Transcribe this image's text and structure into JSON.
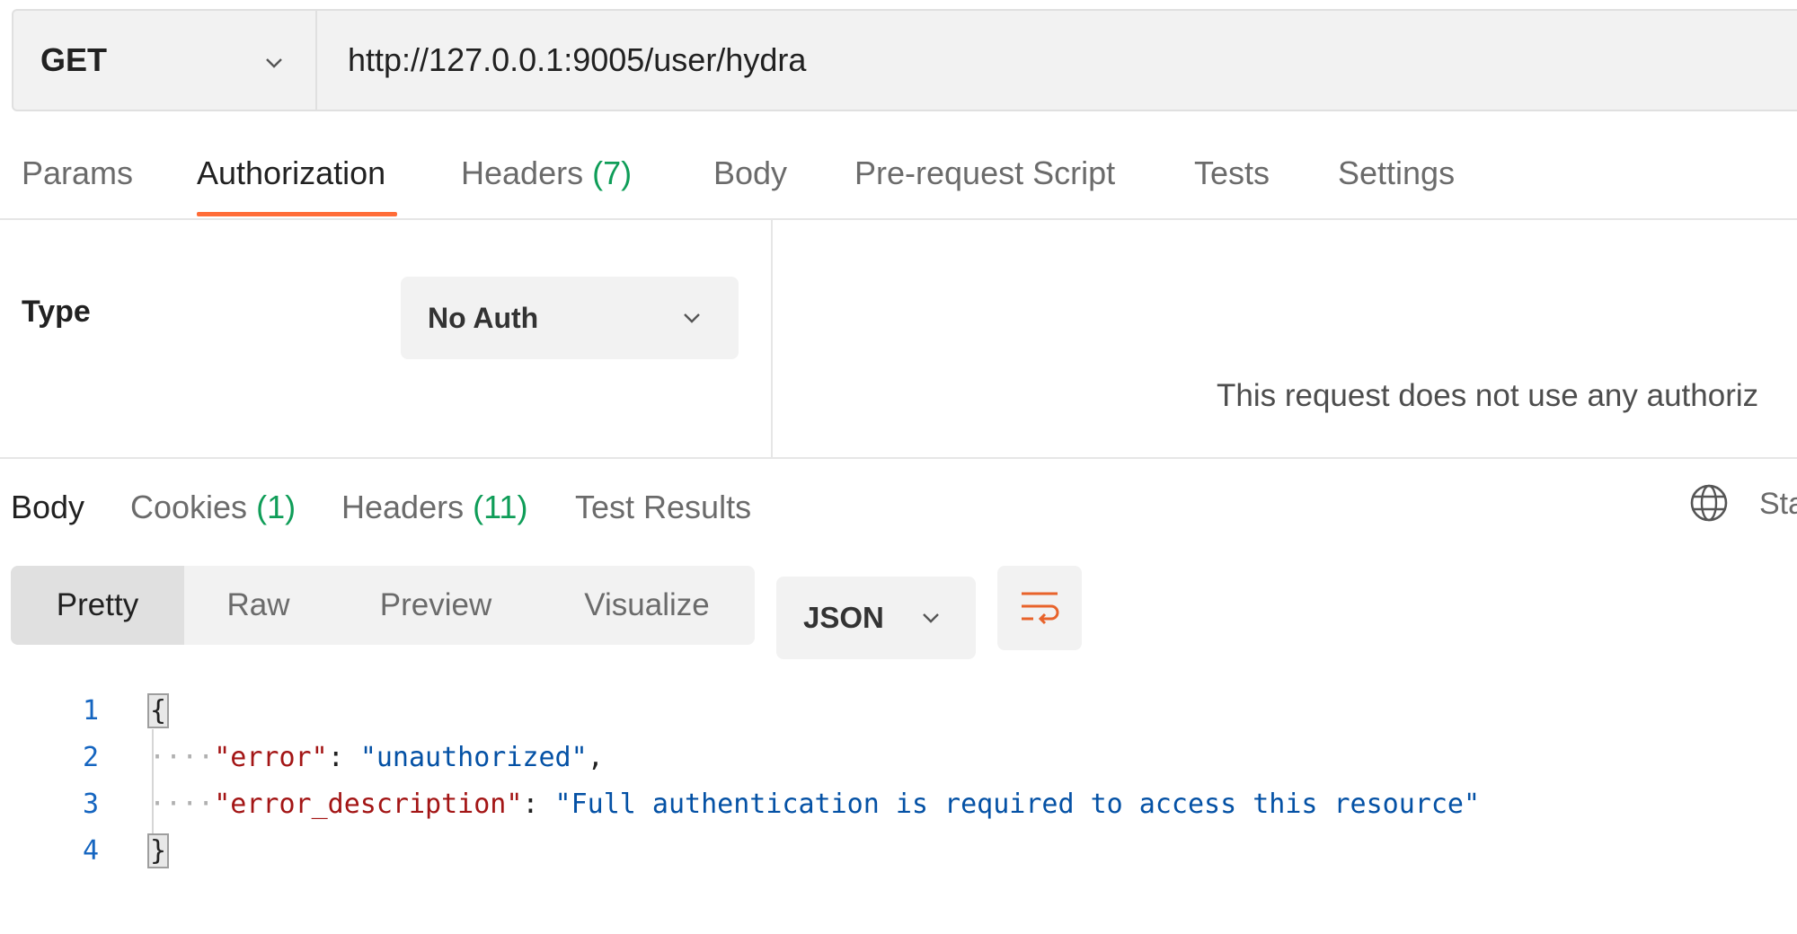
{
  "request": {
    "method": "GET",
    "url": "http://127.0.0.1:9005/user/hydra"
  },
  "request_tabs": [
    {
      "label": "Params",
      "count": ""
    },
    {
      "label": "Authorization",
      "count": "",
      "active": true
    },
    {
      "label": "Headers",
      "count": "(7)"
    },
    {
      "label": "Body",
      "count": ""
    },
    {
      "label": "Pre-request Script",
      "count": ""
    },
    {
      "label": "Tests",
      "count": ""
    },
    {
      "label": "Settings",
      "count": ""
    }
  ],
  "auth": {
    "type_label": "Type",
    "type_value": "No Auth",
    "message": "This request does not use any authoriz"
  },
  "response_tabs": [
    {
      "label": "Body",
      "count": "",
      "active": true
    },
    {
      "label": "Cookies",
      "count": "(1)"
    },
    {
      "label": "Headers",
      "count": "(11)"
    },
    {
      "label": "Test Results",
      "count": ""
    }
  ],
  "status_partial": "Sta",
  "view_modes": [
    "Pretty",
    "Raw",
    "Preview",
    "Visualize"
  ],
  "active_view": "Pretty",
  "format": "JSON",
  "code_lines": [
    {
      "n": "1"
    },
    {
      "n": "2",
      "dots": "····",
      "key": "\"error\"",
      "sep": ": ",
      "value": "\"unauthorized\"",
      "tail": ","
    },
    {
      "n": "3",
      "dots": "····",
      "key": "\"error_description\"",
      "sep": ": ",
      "value": "\"Full authentication is required to access this resource\"",
      "tail": ""
    },
    {
      "n": "4"
    }
  ],
  "braces": {
    "open": "{",
    "close": "}"
  },
  "colors": {
    "accent": "#ff6c37",
    "count_green": "#0f9d58",
    "json_key": "#a31515",
    "json_string": "#0451a5",
    "line_number": "#1565c0"
  },
  "icons": {
    "method_chevron": "chevron-down-icon",
    "globe": "globe-icon",
    "wrap": "wrap-lines-icon"
  }
}
